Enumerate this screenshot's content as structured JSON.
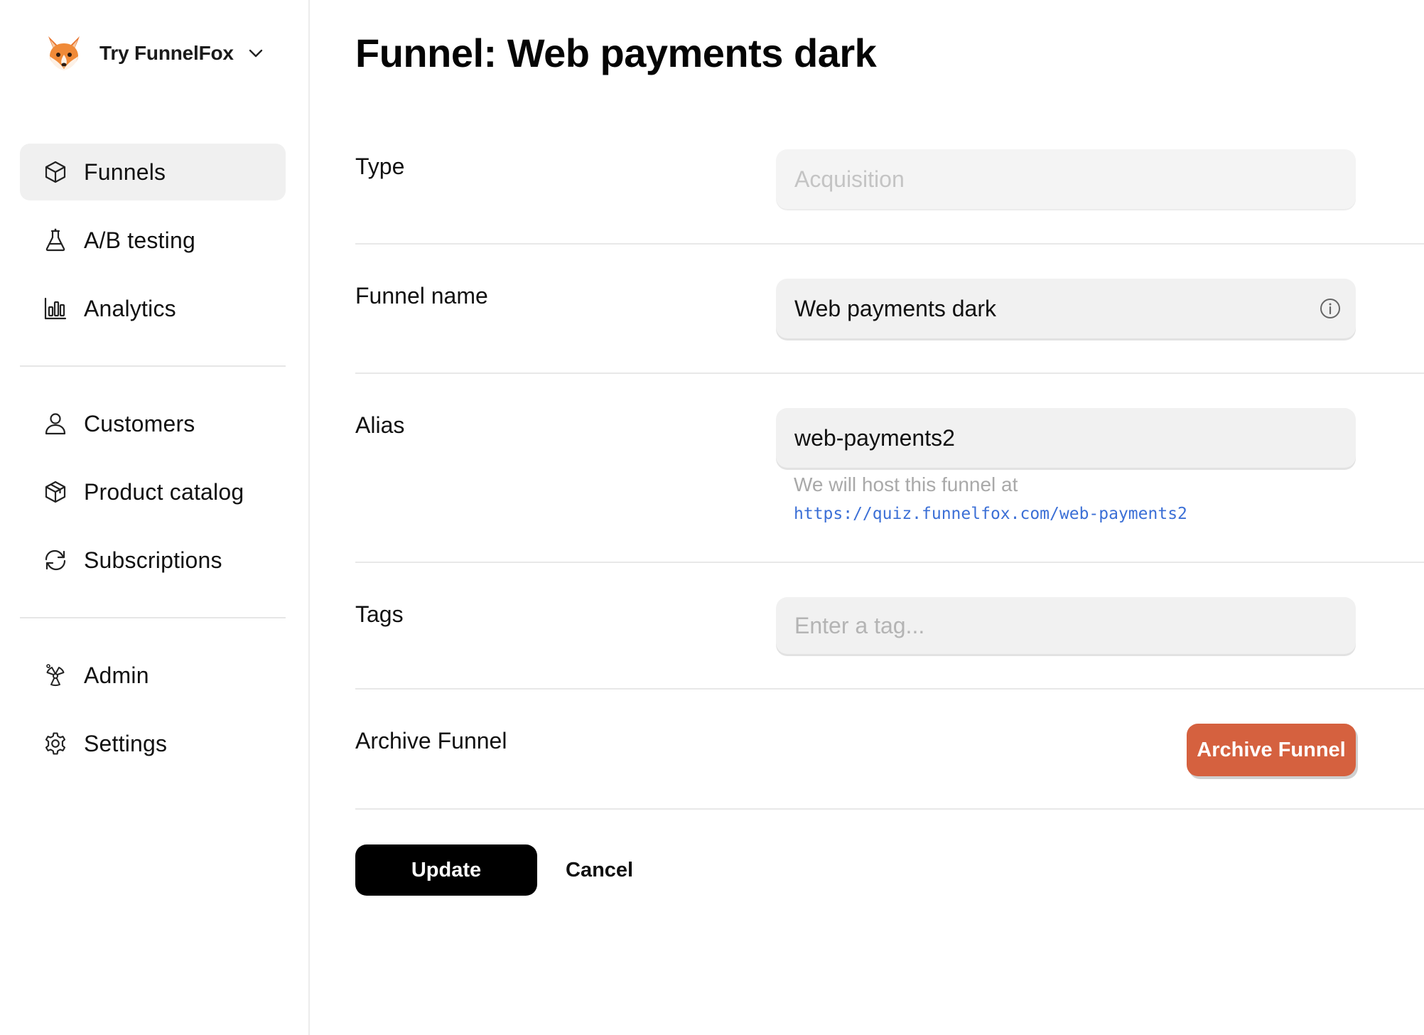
{
  "workspace": {
    "name": "Try FunnelFox",
    "logo_icon": "fox-emoji-icon",
    "chevron_icon": "chevron-down-icon"
  },
  "sidebar": {
    "groups": [
      [
        {
          "label": "Funnels",
          "icon": "cube-icon",
          "active": true
        },
        {
          "label": "A/B testing",
          "icon": "flask-icon",
          "active": false
        },
        {
          "label": "Analytics",
          "icon": "bar-chart-icon",
          "active": false
        }
      ],
      [
        {
          "label": "Customers",
          "icon": "user-icon",
          "active": false
        },
        {
          "label": "Product catalog",
          "icon": "package-icon",
          "active": false
        },
        {
          "label": "Subscriptions",
          "icon": "refresh-icon",
          "active": false
        }
      ],
      [
        {
          "label": "Admin",
          "icon": "radiation-icon",
          "active": false
        },
        {
          "label": "Settings",
          "icon": "gear-icon",
          "active": false
        }
      ]
    ]
  },
  "main": {
    "title": "Funnel: Web payments dark",
    "fields": {
      "type": {
        "label": "Type",
        "value": "Acquisition"
      },
      "funnel_name": {
        "label": "Funnel name",
        "value": "Web payments dark"
      },
      "alias": {
        "label": "Alias",
        "value": "web-payments2",
        "hint": "We will host this funnel at",
        "url": "https://quiz.funnelfox.com/web-payments2"
      },
      "tags": {
        "label": "Tags",
        "placeholder": "Enter a tag..."
      },
      "archive": {
        "label": "Archive Funnel",
        "button_label": "Archive Funnel"
      }
    },
    "actions": {
      "update_label": "Update",
      "cancel_label": "Cancel"
    }
  },
  "colors": {
    "archive_button": "#d5613f",
    "update_button": "#000000",
    "link": "#3b6fd6",
    "active_nav_bg": "#f0f0f0"
  }
}
